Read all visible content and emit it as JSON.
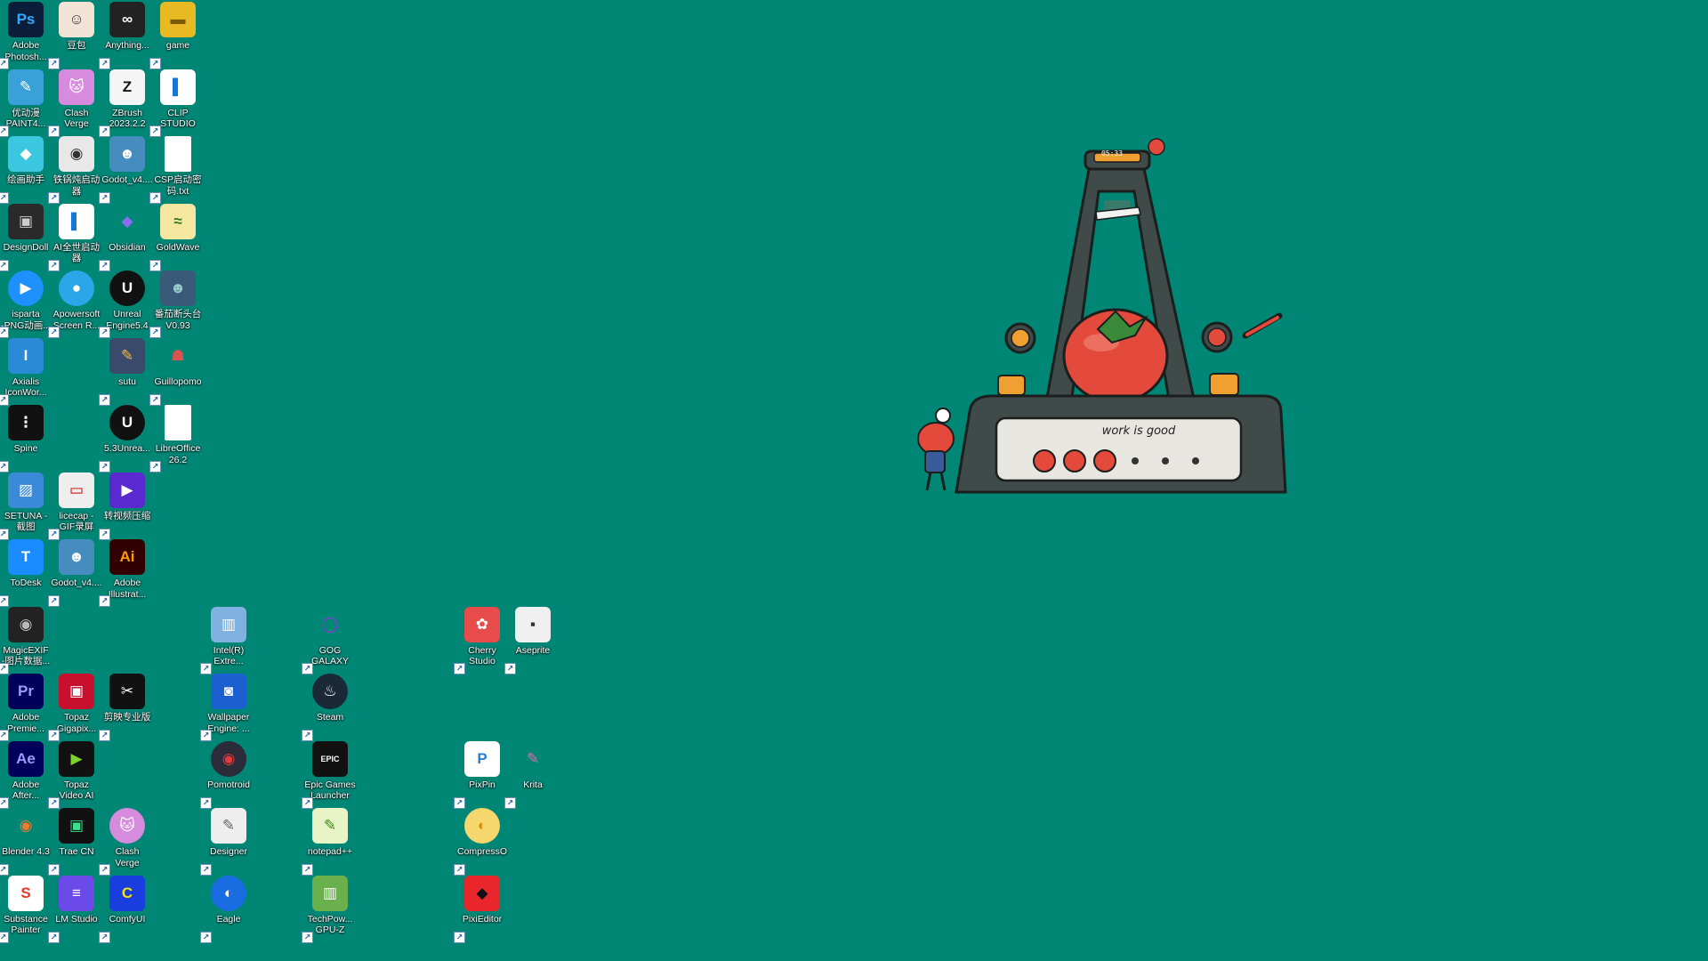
{
  "desktop": {
    "background": "#008675",
    "icons": [
      {
        "label": "Adobe\nPhotosh...",
        "glyph": "Ps",
        "bg": "#0a1e3a",
        "fg": "#31a8ff",
        "icon": "photoshop-icon"
      },
      {
        "label": "豆包",
        "glyph": "☺",
        "bg": "#f1e3d6",
        "fg": "#333",
        "icon": "doubao-icon"
      },
      {
        "label": "Anything...",
        "glyph": "∞",
        "bg": "#222",
        "fg": "#fff",
        "icon": "anything-llm-icon"
      },
      {
        "label": "game",
        "glyph": "▬",
        "bg": "#e8b923",
        "fg": "#7a5a00",
        "icon": "folder-icon"
      },
      {
        "label": "优动漫\nPAINT4...",
        "glyph": "✎",
        "bg": "#3aa0d8",
        "fg": "#fff",
        "icon": "paint-app-icon"
      },
      {
        "label": "Clash\nVerge",
        "glyph": "🐱",
        "bg": "#d78bdf",
        "fg": "#fff",
        "icon": "clash-verge-icon"
      },
      {
        "label": "ZBrush\n2023.2.2",
        "glyph": "Z",
        "bg": "#f5f5f5",
        "fg": "#111",
        "icon": "zbrush-icon"
      },
      {
        "label": "CLIP\nSTUDIO",
        "glyph": "▌",
        "bg": "#fff",
        "fg": "#1577d3",
        "icon": "clip-studio-icon"
      },
      {
        "label": "绘画助手",
        "glyph": "◆",
        "bg": "#3cc7e0",
        "fg": "#fff",
        "icon": "drawing-assistant-icon"
      },
      {
        "label": "铁锅炖启动\n器",
        "glyph": "◉",
        "bg": "#e8e8e8",
        "fg": "#333",
        "icon": "launcher-icon"
      },
      {
        "label": "Godot_v4....",
        "glyph": "☻",
        "bg": "#478cbf",
        "fg": "#fff",
        "icon": "godot-icon"
      },
      {
        "label": "CSP启动密\n码.txt",
        "glyph": "",
        "bg": "#fff",
        "fg": "#555",
        "icon": "text-file-icon",
        "file": true
      },
      {
        "label": "DesignDoll",
        "glyph": "▣",
        "bg": "#2a2a2a",
        "fg": "#ccc",
        "icon": "designdoll-icon"
      },
      {
        "label": "AI全世启动器",
        "glyph": "▌",
        "bg": "#fff",
        "fg": "#1577d3",
        "icon": "ai-launcher-icon"
      },
      {
        "label": "Obsidian",
        "glyph": "◆",
        "bg": "#008675",
        "fg": "#8b6cef",
        "icon": "obsidian-icon"
      },
      {
        "label": "GoldWave",
        "glyph": "≈",
        "bg": "#f5e6a0",
        "fg": "#2a7a2a",
        "icon": "goldwave-icon"
      },
      {
        "label": "isparta\n-PNG动画...",
        "glyph": "▶",
        "bg": "#1e90ff",
        "fg": "#fff",
        "icon": "isparta-icon",
        "round": true
      },
      {
        "label": "Apowersoft\nScreen R...",
        "glyph": "●",
        "bg": "#2aa7e8",
        "fg": "#fff",
        "icon": "apowersoft-icon",
        "round": true
      },
      {
        "label": "Unreal\nEngine5.4",
        "glyph": "U",
        "bg": "#111",
        "fg": "#fff",
        "icon": "unreal-engine-icon",
        "round": true
      },
      {
        "label": "番茄断头台\nV0.93",
        "glyph": "☻",
        "bg": "#3a5a7a",
        "fg": "#9cc",
        "icon": "tomato-guillotine-icon"
      },
      {
        "label": "Axialis\nIconWor...",
        "glyph": "I",
        "bg": "#2b8ad8",
        "fg": "#fff",
        "icon": "axialis-icon"
      },
      {
        "label": "",
        "glyph": "",
        "bg": "transparent",
        "fg": "#fff",
        "icon": "empty-slot",
        "empty": true
      },
      {
        "label": "sutu",
        "glyph": "✎",
        "bg": "#3a4a6a",
        "fg": "#f5b942",
        "icon": "sutu-icon"
      },
      {
        "label": "Guillopomo",
        "glyph": "☗",
        "bg": "#008675",
        "fg": "#d9534f",
        "icon": "guillopomo-icon"
      },
      {
        "label": "Spine",
        "glyph": "⋮",
        "bg": "#111",
        "fg": "#fff",
        "icon": "spine-icon"
      },
      {
        "label": "",
        "glyph": "",
        "bg": "transparent",
        "fg": "#fff",
        "icon": "empty-slot",
        "empty": true
      },
      {
        "label": "5.3Unrea...",
        "glyph": "U",
        "bg": "#111",
        "fg": "#fff",
        "icon": "unreal-engine-icon",
        "round": true
      },
      {
        "label": "LibreOffice\n26.2",
        "glyph": "",
        "bg": "#fff",
        "fg": "#555",
        "icon": "libreoffice-icon",
        "file": true
      },
      {
        "label": "SETUNA -\n截图",
        "glyph": "▨",
        "bg": "#3a8ad8",
        "fg": "#fff",
        "icon": "setuna-icon"
      },
      {
        "label": "licecap -\nGIF录屏",
        "glyph": "▭",
        "bg": "#eee",
        "fg": "#c00",
        "icon": "licecap-icon"
      },
      {
        "label": "转视频压缩",
        "glyph": "▶",
        "bg": "#5a2ad0",
        "fg": "#fff",
        "icon": "video-compress-icon"
      },
      {
        "label": "",
        "glyph": "",
        "bg": "transparent",
        "fg": "#fff",
        "icon": "empty-slot",
        "empty": true
      },
      {
        "label": "ToDesk",
        "glyph": "T",
        "bg": "#1a8cff",
        "fg": "#fff",
        "icon": "todesk-icon"
      },
      {
        "label": "Godot_v4....",
        "glyph": "☻",
        "bg": "#478cbf",
        "fg": "#fff",
        "icon": "godot-icon"
      },
      {
        "label": "Adobe\nIllustrat...",
        "glyph": "Ai",
        "bg": "#330000",
        "fg": "#ff9a00",
        "icon": "illustrator-icon"
      }
    ],
    "lower_icons": [
      {
        "label": "MagicEXIF\n-图片数据...",
        "glyph": "◉",
        "bg": "#222",
        "fg": "#bbb",
        "icon": "magicexif-icon",
        "col": 0,
        "row": 0
      },
      {
        "label": "Intel(R)\nExtre...",
        "glyph": "▥",
        "bg": "#7fb2e0",
        "fg": "#fff",
        "icon": "intel-xtu-icon",
        "col": 4,
        "row": 0
      },
      {
        "label": "GOG\nGALAXY",
        "glyph": "◯",
        "bg": "#008675",
        "fg": "#9b2ee8",
        "icon": "gog-galaxy-icon",
        "col": 6,
        "row": 0
      },
      {
        "label": "Cherry\nStudio",
        "glyph": "✿",
        "bg": "#e84b4b",
        "fg": "#fff",
        "icon": "cherry-studio-icon",
        "col": 9,
        "row": 0
      },
      {
        "label": "Aseprite",
        "glyph": "▪",
        "bg": "#f0f0f0",
        "fg": "#333",
        "icon": "aseprite-icon",
        "col": 10,
        "row": 0
      },
      {
        "label": "Adobe\nPremie...",
        "glyph": "Pr",
        "bg": "#00005b",
        "fg": "#9999ff",
        "icon": "premiere-icon",
        "col": 0,
        "row": 1
      },
      {
        "label": "Topaz\nGigapix...",
        "glyph": "▣",
        "bg": "#c8102e",
        "fg": "#fff",
        "icon": "topaz-gigapixel-icon",
        "col": 1,
        "row": 1
      },
      {
        "label": "剪映专业版",
        "glyph": "✂",
        "bg": "#111",
        "fg": "#fff",
        "icon": "capcut-icon",
        "col": 2,
        "row": 1
      },
      {
        "label": "Wallpaper\nEngine: ...",
        "glyph": "◙",
        "bg": "#1b5fd1",
        "fg": "#fff",
        "icon": "wallpaper-engine-icon",
        "col": 4,
        "row": 1
      },
      {
        "label": "Steam",
        "glyph": "♨",
        "bg": "#1b2838",
        "fg": "#fff",
        "icon": "steam-icon",
        "col": 6,
        "row": 1,
        "round": true
      },
      {
        "label": "Adobe\nAfter...",
        "glyph": "Ae",
        "bg": "#00005b",
        "fg": "#9999ff",
        "icon": "after-effects-icon",
        "col": 0,
        "row": 2
      },
      {
        "label": "Topaz\nVideo AI",
        "glyph": "▶",
        "bg": "#111",
        "fg": "#7cd32b",
        "icon": "topaz-video-icon",
        "col": 1,
        "row": 2
      },
      {
        "label": "Pomotroid",
        "glyph": "◉",
        "bg": "#2b2b3a",
        "fg": "#e23b3b",
        "icon": "pomotroid-icon",
        "col": 4,
        "row": 2,
        "round": true
      },
      {
        "label": "Epic Games\nLauncher",
        "glyph": "EPIC",
        "bg": "#111",
        "fg": "#fff",
        "icon": "epic-games-icon",
        "col": 6,
        "row": 2
      },
      {
        "label": "PixPin",
        "glyph": "P",
        "bg": "#fff",
        "fg": "#2a7bd8",
        "icon": "pixpin-icon",
        "col": 9,
        "row": 2
      },
      {
        "label": "Krita",
        "glyph": "✎",
        "bg": "#008675",
        "fg": "#e86aa8",
        "icon": "krita-icon",
        "col": 10,
        "row": 2,
        "round": true
      },
      {
        "label": "Blender 4.3",
        "glyph": "◉",
        "bg": "#008675",
        "fg": "#f5792a",
        "icon": "blender-icon",
        "col": 0,
        "row": 3
      },
      {
        "label": "Trae CN",
        "glyph": "▣",
        "bg": "#111",
        "fg": "#3de08a",
        "icon": "trae-icon",
        "col": 1,
        "row": 3
      },
      {
        "label": "Clash\nVerge",
        "glyph": "🐱",
        "bg": "#d78bdf",
        "fg": "#fff",
        "icon": "clash-verge-icon",
        "col": 2,
        "row": 3,
        "round": true
      },
      {
        "label": "Designer",
        "glyph": "✎",
        "bg": "#eee",
        "fg": "#666",
        "icon": "designer-icon",
        "col": 4,
        "row": 3
      },
      {
        "label": "notepad++",
        "glyph": "✎",
        "bg": "#e8f4c8",
        "fg": "#3a8a1a",
        "icon": "notepad-plus-plus-icon",
        "col": 6,
        "row": 3
      },
      {
        "label": "CompressO",
        "glyph": "◐",
        "bg": "#f5d76e",
        "fg": "#e88a00",
        "icon": "compresso-icon",
        "col": 9,
        "row": 3,
        "round": true
      },
      {
        "label": "Substance\nPainter",
        "glyph": "S",
        "bg": "#fff",
        "fg": "#e8362c",
        "icon": "substance-painter-icon",
        "col": 0,
        "row": 4
      },
      {
        "label": "LM Studio",
        "glyph": "≡",
        "bg": "#6a4ae8",
        "fg": "#fff",
        "icon": "lm-studio-icon",
        "col": 1,
        "row": 4
      },
      {
        "label": "ComfyUI",
        "glyph": "C",
        "bg": "#1a3de0",
        "fg": "#f5e600",
        "icon": "comfyui-icon",
        "col": 2,
        "row": 4
      },
      {
        "label": "Eagle",
        "glyph": "◐",
        "bg": "#1a6de0",
        "fg": "#fff",
        "icon": "eagle-icon",
        "col": 4,
        "row": 4,
        "round": true
      },
      {
        "label": "TechPow...\nGPU-Z",
        "glyph": "▥",
        "bg": "#6ab04c",
        "fg": "#fff",
        "icon": "gpu-z-icon",
        "col": 6,
        "row": 4
      },
      {
        "label": "PixiEditor",
        "glyph": "◆",
        "bg": "#e8262c",
        "fg": "#111",
        "icon": "pixieditor-icon",
        "col": 9,
        "row": 4
      }
    ]
  },
  "widget": {
    "name": "Guillopomo",
    "time": "05:33",
    "task_text": "work is good",
    "pomodoros_total": 6,
    "pomodoros_done": 3,
    "colors": {
      "frame": "#404a48",
      "tomato": "#e34a3c",
      "leaf": "#3a8a3a",
      "accent": "#f0a030",
      "panel": "#e8e6e0"
    }
  }
}
